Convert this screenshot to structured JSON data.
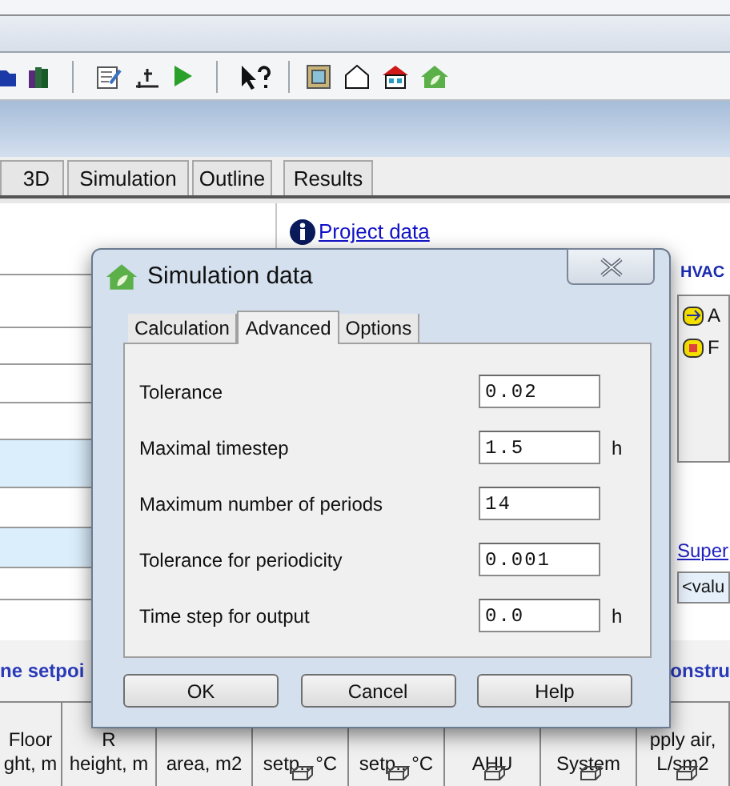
{
  "tabs": [
    {
      "label": "3D"
    },
    {
      "label": "Simulation"
    },
    {
      "label": "Outline"
    },
    {
      "label": "Results"
    }
  ],
  "project_link": "Project data",
  "form_rows": [
    {
      "highlighted": false
    },
    {
      "highlighted": false
    },
    {
      "highlighted": false
    },
    {
      "highlighted": false
    },
    {
      "highlighted": false
    },
    {
      "highlighted": true
    },
    {
      "highlighted": false
    },
    {
      "highlighted": true
    },
    {
      "highlighted": false
    }
  ],
  "hvac": {
    "label": "HVAC",
    "items": [
      {
        "label": "A",
        "kind": "ahu"
      },
      {
        "label": "F",
        "kind": "fan"
      }
    ]
  },
  "super_link": "Super",
  "value_field": "<valu",
  "section_labels": [
    "ne setpoi",
    "onstru"
  ],
  "table": {
    "columns": [
      {
        "lines": [
          "Floor",
          "ght, m"
        ],
        "icon": false
      },
      {
        "lines": [
          "R",
          "height, m"
        ],
        "icon": false
      },
      {
        "lines": [
          "area, m2"
        ],
        "icon": false
      },
      {
        "lines": [
          "setp., °C"
        ],
        "icon": true
      },
      {
        "lines": [
          "setp., °C"
        ],
        "icon": true
      },
      {
        "lines": [
          "AHU"
        ],
        "icon": true
      },
      {
        "lines": [
          "System"
        ],
        "icon": true
      },
      {
        "lines": [
          "pply air,",
          "L/sm2"
        ],
        "icon": true
      }
    ]
  },
  "dialog": {
    "title": "Simulation data",
    "tabs": [
      {
        "label": "Calculation",
        "selected": false
      },
      {
        "label": "Advanced",
        "selected": true
      },
      {
        "label": "Options",
        "selected": false
      }
    ],
    "fields": [
      {
        "label": "Tolerance",
        "value": "0.02"
      },
      {
        "label": "Maximal timestep",
        "value": "1.5",
        "unit": "h"
      },
      {
        "label": "Maximum number of periods",
        "value": "14"
      },
      {
        "label": "Tolerance for periodicity",
        "value": "0.001"
      },
      {
        "label": "Time step for output",
        "value": "0.0",
        "unit": "h"
      }
    ],
    "buttons": [
      "OK",
      "Cancel",
      "Help"
    ]
  }
}
